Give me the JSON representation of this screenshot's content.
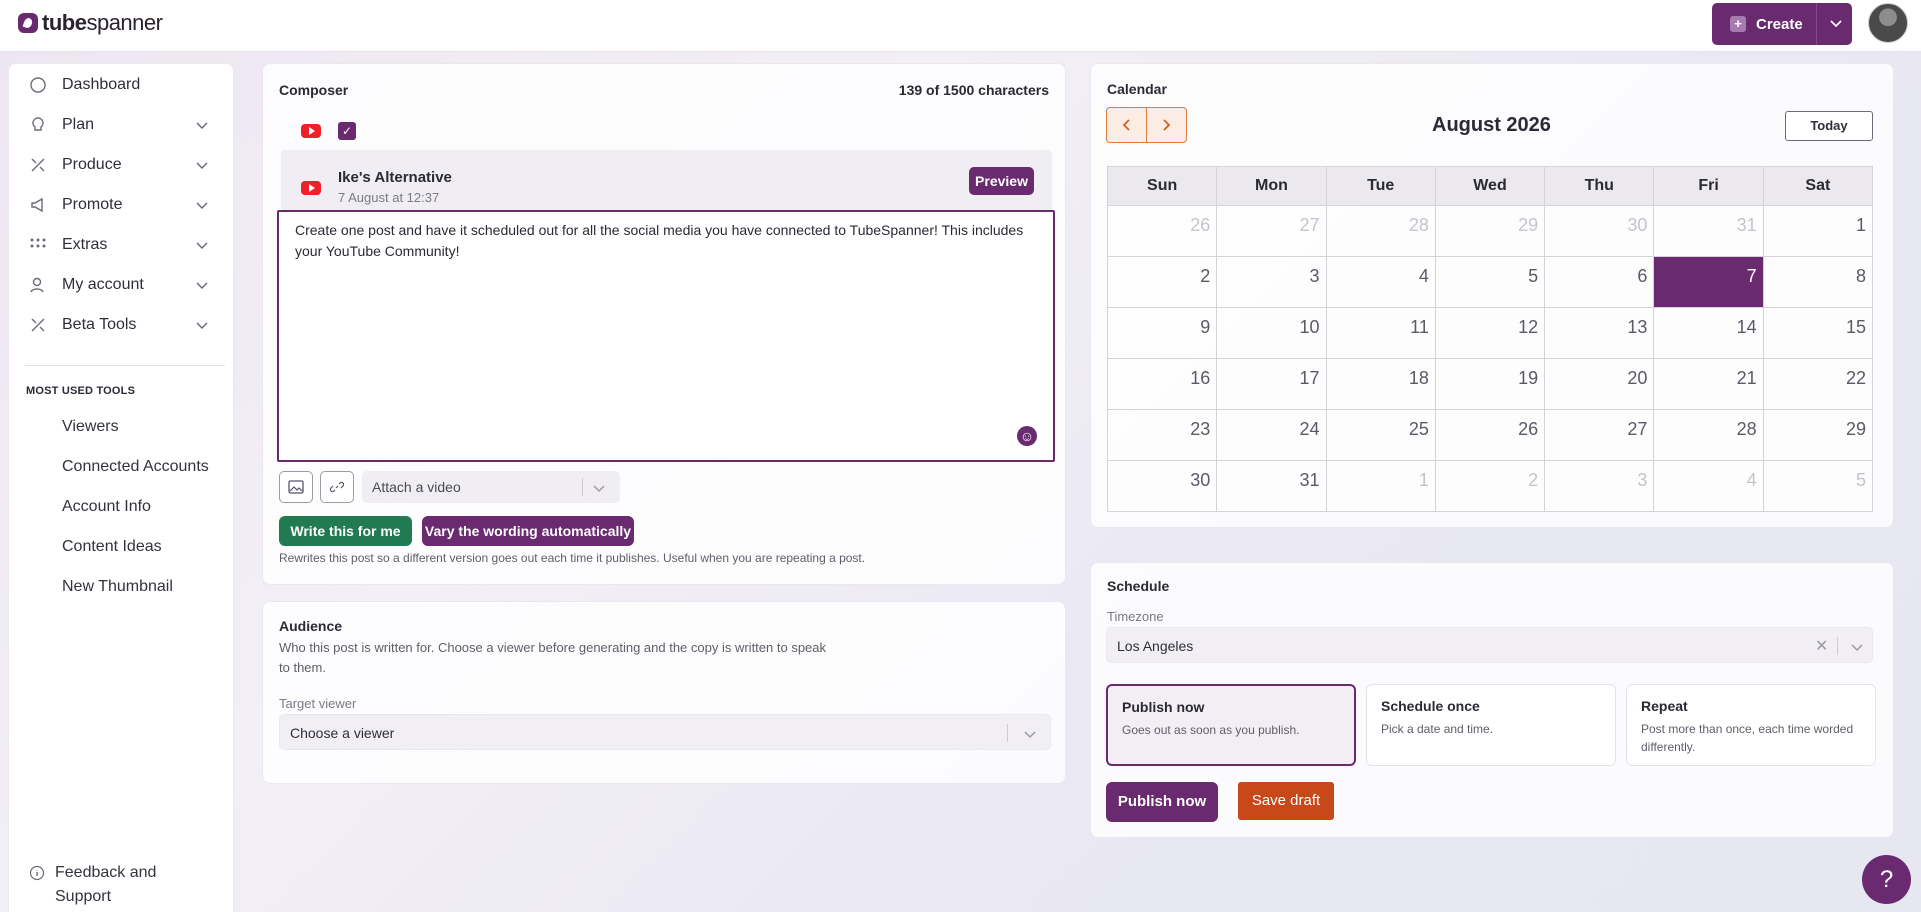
{
  "brand": {
    "name_bold": "tube",
    "name_light": "spanner"
  },
  "header": {
    "create_label": "Create"
  },
  "sidebar": {
    "nav": [
      {
        "label": "Dashboard",
        "icon": "home-icon"
      },
      {
        "label": "Plan",
        "icon": "lightbulb-icon"
      },
      {
        "label": "Produce",
        "icon": "tools-icon"
      },
      {
        "label": "Promote",
        "icon": "megaphone-icon"
      },
      {
        "label": "Extras",
        "icon": "grid-dots-icon"
      },
      {
        "label": "My account",
        "icon": "user-icon"
      },
      {
        "label": "Beta Tools",
        "icon": "tools-icon"
      }
    ],
    "most_used_heading": "MOST USED TOOLS",
    "tools": [
      "Viewers",
      "Connected Accounts",
      "Account Info",
      "Content Ideas",
      "New Thumbnail"
    ],
    "feedback_label": "Feedback and Support"
  },
  "composer": {
    "title": "Composer",
    "char_count": "139 of 1500 characters",
    "account_name": "Ike's Alternative",
    "post_time": "7 August at 12:37",
    "preview_label": "Preview",
    "post_text": "Create one post and have it scheduled out for all the social media you have connected to TubeSpanner! This includes your YouTube Community!",
    "attach_placeholder": "Attach a video",
    "write_label": "Write this for me",
    "vary_label": "Vary the wording automatically",
    "help_text": "Rewrites this post so a different version goes out each time it publishes. Useful when you are repeating a post."
  },
  "audience": {
    "title": "Audience",
    "description": "Who this post is written for. Choose a viewer before generating and the copy is written to speak to them.",
    "target_label": "Target viewer",
    "target_placeholder": "Choose a viewer"
  },
  "calendar": {
    "title": "Calendar",
    "month_label": "August 2026",
    "today_label": "Today",
    "weekdays": [
      "Sun",
      "Mon",
      "Tue",
      "Wed",
      "Thu",
      "Fri",
      "Sat"
    ],
    "weeks": [
      [
        "26",
        "27",
        "28",
        "29",
        "30",
        "31",
        "1"
      ],
      [
        "2",
        "3",
        "4",
        "5",
        "6",
        "7",
        "8"
      ],
      [
        "9",
        "10",
        "11",
        "12",
        "13",
        "14",
        "15"
      ],
      [
        "16",
        "17",
        "18",
        "19",
        "20",
        "21",
        "22"
      ],
      [
        "23",
        "24",
        "25",
        "26",
        "27",
        "28",
        "29"
      ],
      [
        "30",
        "31",
        "1",
        "2",
        "3",
        "4",
        "5"
      ]
    ],
    "selected_day": "7"
  },
  "schedule": {
    "title": "Schedule",
    "timezone_label": "Timezone",
    "timezone_value": "Los Angeles",
    "options": [
      {
        "title": "Publish now",
        "desc": "Goes out as soon as you publish."
      },
      {
        "title": "Schedule once",
        "desc": "Pick a date and time."
      },
      {
        "title": "Repeat",
        "desc": "Post more than once, each time worded differently."
      }
    ],
    "publish_label": "Publish now",
    "draft_label": "Save draft"
  },
  "help_fab_label": "?",
  "colors": {
    "brand": "#6a2a6f",
    "green": "#217a52",
    "orange": "#c8481a",
    "youtube": "#f0202a"
  }
}
